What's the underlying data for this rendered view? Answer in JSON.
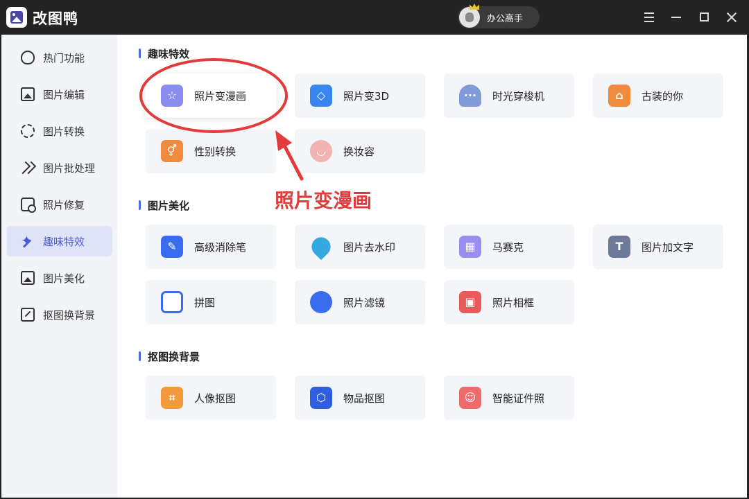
{
  "app": {
    "title": "改图鸭"
  },
  "user": {
    "name": "办公高手"
  },
  "sidebar": {
    "items": [
      {
        "label": "热门功能",
        "icon": "flame-icon",
        "active": false
      },
      {
        "label": "图片编辑",
        "icon": "image-edit-icon",
        "active": false
      },
      {
        "label": "图片转换",
        "icon": "convert-icon",
        "active": false
      },
      {
        "label": "图片批处理",
        "icon": "batch-icon",
        "active": false
      },
      {
        "label": "照片修复",
        "icon": "repair-icon",
        "active": false
      },
      {
        "label": "趣味特效",
        "icon": "sparkle-icon",
        "active": true
      },
      {
        "label": "图片美化",
        "icon": "beautify-icon",
        "active": false
      },
      {
        "label": "抠图换背景",
        "icon": "cutout-icon",
        "active": false
      }
    ]
  },
  "sections": [
    {
      "title": "趣味特效",
      "cards": [
        {
          "label": "照片变漫画",
          "icon": "cartoon-icon"
        },
        {
          "label": "照片变3D",
          "icon": "cube-3d-icon"
        },
        {
          "label": "时光穿梭机",
          "icon": "time-machine-icon"
        },
        {
          "label": "古装的你",
          "icon": "ancient-costume-icon"
        },
        {
          "label": "性别转换",
          "icon": "gender-swap-icon"
        },
        {
          "label": "换妆容",
          "icon": "makeup-icon"
        }
      ]
    },
    {
      "title": "图片美化",
      "cards": [
        {
          "label": "高级消除笔",
          "icon": "eraser-icon"
        },
        {
          "label": "图片去水印",
          "icon": "watermark-remove-icon"
        },
        {
          "label": "马赛克",
          "icon": "mosaic-icon"
        },
        {
          "label": "图片加文字",
          "icon": "add-text-icon"
        },
        {
          "label": "拼图",
          "icon": "collage-icon"
        },
        {
          "label": "照片滤镜",
          "icon": "filter-icon"
        },
        {
          "label": "照片相框",
          "icon": "frame-icon"
        }
      ]
    },
    {
      "title": "抠图换背景",
      "cards": [
        {
          "label": "人像抠图",
          "icon": "portrait-cutout-icon"
        },
        {
          "label": "物品抠图",
          "icon": "object-cutout-icon"
        },
        {
          "label": "智能证件照",
          "icon": "id-photo-icon"
        }
      ]
    }
  ],
  "annotation": {
    "text": "照片变漫画",
    "color": "#e23b3b"
  },
  "colors": {
    "accent": "#4a5bd8",
    "titlebar": "#242424",
    "sidebar_bg": "#f3f4f7",
    "card_bg": "#f4f5f8"
  }
}
